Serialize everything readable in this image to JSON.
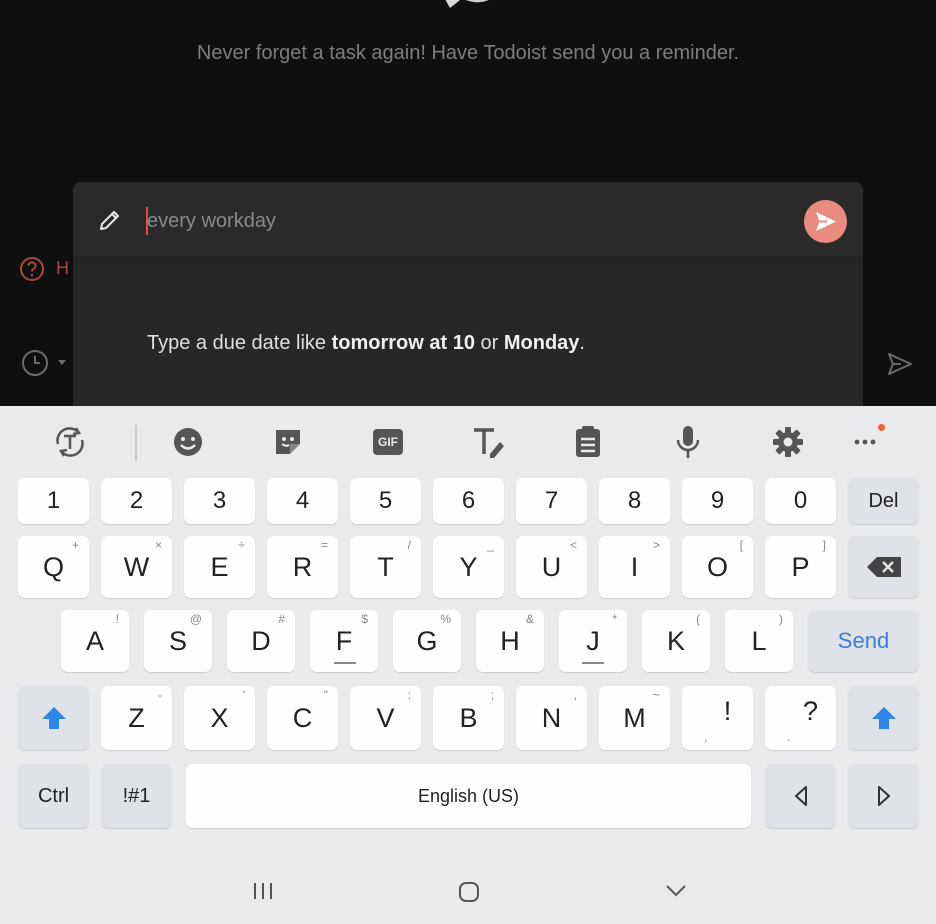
{
  "app": {
    "reminder_text": "Never forget a task again! Have Todoist send you a reminder.",
    "help_text": "H"
  },
  "quick_add": {
    "input_value": "every workday",
    "hint_prefix": "Type a due date like ",
    "hint_bold1": "tomorrow at 10",
    "hint_mid": " or ",
    "hint_bold2": "Monday",
    "hint_suffix": "."
  },
  "keyboard": {
    "toolbar": [
      "text-recognition-icon",
      "emoji-icon",
      "sticker-icon",
      "gif-icon",
      "text-style-icon",
      "clipboard-icon",
      "microphone-icon",
      "settings-icon",
      "more-icon"
    ],
    "gif_label": "GIF",
    "number_row": [
      "1",
      "2",
      "3",
      "4",
      "5",
      "6",
      "7",
      "8",
      "9",
      "0"
    ],
    "del_label": "Del",
    "row_q": [
      {
        "k": "Q",
        "s": "+"
      },
      {
        "k": "W",
        "s": "×"
      },
      {
        "k": "E",
        "s": "÷"
      },
      {
        "k": "R",
        "s": "="
      },
      {
        "k": "T",
        "s": "/"
      },
      {
        "k": "Y",
        "s": "_"
      },
      {
        "k": "U",
        "s": "<"
      },
      {
        "k": "I",
        "s": ">"
      },
      {
        "k": "O",
        "s": "["
      },
      {
        "k": "P",
        "s": "]"
      }
    ],
    "row_a": [
      {
        "k": "A",
        "s": "!"
      },
      {
        "k": "S",
        "s": "@"
      },
      {
        "k": "D",
        "s": "#"
      },
      {
        "k": "F",
        "s": "$"
      },
      {
        "k": "G",
        "s": "%"
      },
      {
        "k": "H",
        "s": "&"
      },
      {
        "k": "J",
        "s": "*"
      },
      {
        "k": "K",
        "s": "("
      },
      {
        "k": "L",
        "s": ")"
      }
    ],
    "send_label": "Send",
    "row_z": [
      {
        "k": "Z",
        "s": "-"
      },
      {
        "k": "X",
        "s": "'"
      },
      {
        "k": "C",
        "s": "\""
      },
      {
        "k": "V",
        "s": ":"
      },
      {
        "k": "B",
        "s": ";"
      },
      {
        "k": "N",
        "s": ","
      },
      {
        "k": "M",
        "s": "~"
      },
      {
        "k": "!",
        "s": ","
      },
      {
        "k": "?",
        "s": "."
      }
    ],
    "ctrl_label": "Ctrl",
    "symbols_label": "!#1",
    "space_label": "English (US)"
  },
  "colors": {
    "accent": "#e98b7f",
    "send_blue": "#3a7fd5",
    "shift_blue": "#2f86e8"
  }
}
